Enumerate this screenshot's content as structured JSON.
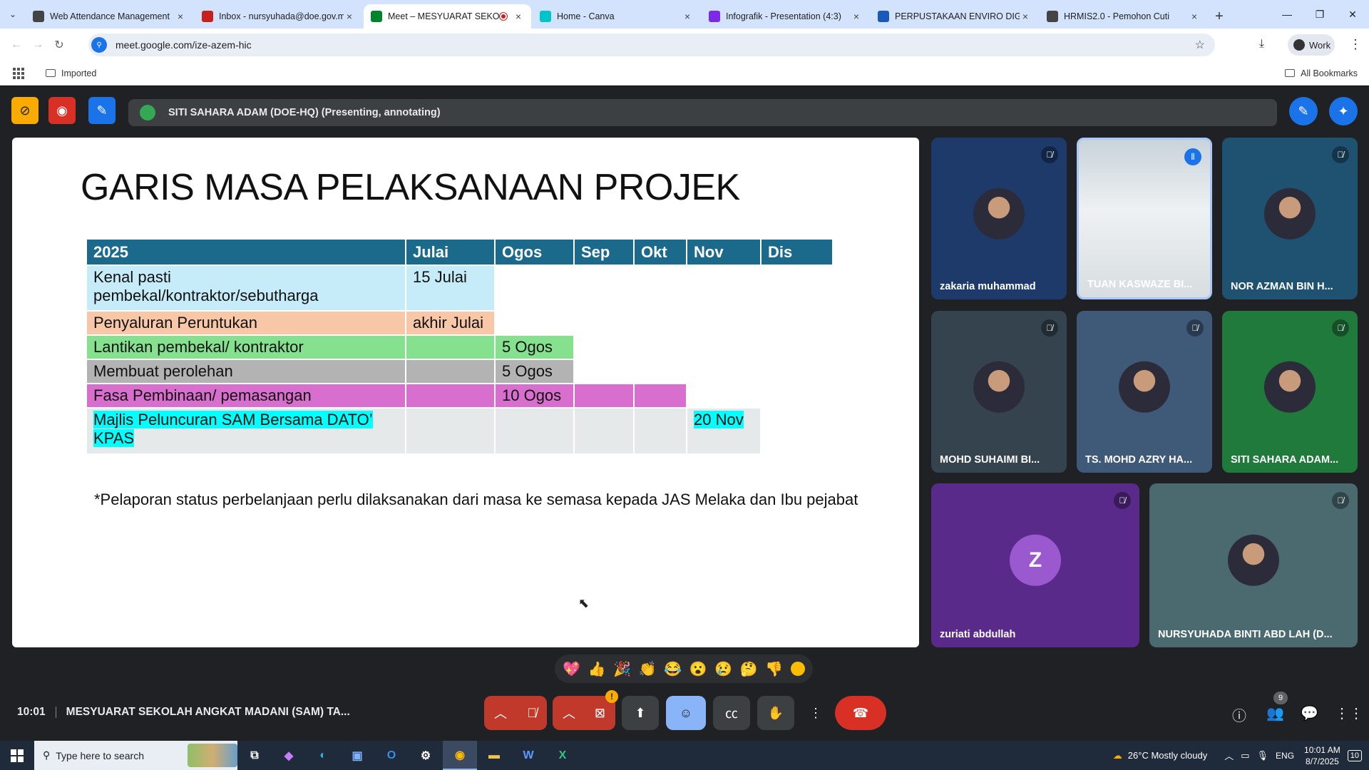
{
  "tabs": [
    {
      "title": "Web Attendance Management",
      "color": "#444"
    },
    {
      "title": "Inbox - nursyuhada@doe.gov.m",
      "color": "#c5221f"
    },
    {
      "title": "Meet – MESYUARAT SEKOL",
      "color": "#00832d",
      "active": true
    },
    {
      "title": "Home - Canva",
      "color": "#00c4cc"
    },
    {
      "title": "Infografik - Presentation (4:3)",
      "color": "#7d2ae8"
    },
    {
      "title": "PERPUSTAKAAN ENVIRO DIGIT",
      "color": "#185abc"
    },
    {
      "title": "HRMIS2.0 - Pemohon Cuti",
      "color": "#444"
    }
  ],
  "address": {
    "url": "meet.google.com/ize-azem-hic"
  },
  "profile": {
    "label": "Work"
  },
  "bookmarks": {
    "folder": "Imported",
    "all": "All Bookmarks"
  },
  "presenter": {
    "text": "SITI SAHARA ADAM (DOE-HQ) (Presenting, annotating)"
  },
  "slide": {
    "title": "GARIS MASA PELAKSANAAN PROJEK",
    "headers": [
      "2025",
      "Julai",
      "Ogos",
      "Sep",
      "Okt",
      "Nov",
      "Dis"
    ],
    "rows": [
      {
        "label": "Kenal pasti pembekal/kontraktor/sebutharga",
        "cells": [
          "15 Julai",
          "",
          "",
          "",
          "",
          ""
        ]
      },
      {
        "label": "Penyaluran Peruntukan",
        "cells": [
          "akhir Julai",
          "",
          "",
          "",
          "",
          ""
        ]
      },
      {
        "label": "Lantikan pembekal/ kontraktor",
        "cells": [
          "",
          "5 Ogos",
          "",
          "",
          "",
          ""
        ]
      },
      {
        "label": "Membuat perolehan",
        "cells": [
          "",
          "5 Ogos",
          "",
          "",
          "",
          ""
        ]
      },
      {
        "label": "Fasa Pembinaan/ pemasangan",
        "cells": [
          "",
          "10 Ogos",
          "",
          "",
          "",
          ""
        ]
      },
      {
        "label": "Majlis Peluncuran SAM Bersama DATO’ KPAS",
        "cells": [
          "",
          "",
          "",
          "",
          "20 Nov",
          ""
        ]
      }
    ],
    "row_colors": [
      "#c5ecf8",
      "#f7c7a8",
      "#86e18f",
      "#b3b3b3",
      "#d86fcf",
      "#e6e9ea"
    ],
    "footnote": "*Pelaporan status perbelanjaan perlu dilaksanakan dari masa ke semasa kepada JAS Melaka dan Ibu pejabat"
  },
  "participants": [
    {
      "name": "zakaria muhammad",
      "bg": "#1e3a6a",
      "muted": true
    },
    {
      "name": "TUAN KASWAZE BI...",
      "bg": "#9aa7b0",
      "muted": false,
      "video": true
    },
    {
      "name": "NOR AZMAN BIN H...",
      "bg": "#1e5270",
      "muted": true
    },
    {
      "name": "MOHD SUHAIMI BI...",
      "bg": "#34434e",
      "muted": true
    },
    {
      "name": "TS. MOHD AZRY HA...",
      "bg": "#3f5a78",
      "muted": true
    },
    {
      "name": "SITI SAHARA ADAM...",
      "bg": "#1f7a3b",
      "muted": true
    },
    {
      "name": "zuriati abdullah",
      "bg": "#5a2a8a",
      "muted": true,
      "initial": "Z"
    },
    {
      "name": "NURSYUHADA BINTI ABD LAH (D...",
      "bg": "#4a6a70",
      "muted": true
    }
  ],
  "reactions": [
    "💖",
    "👍",
    "🎉",
    "👏",
    "😂",
    "😮",
    "😢",
    "🤔",
    "👎"
  ],
  "meeting": {
    "time": "10:01",
    "title": "MESYUARAT SEKOLAH ANGKAT MADANI (SAM) TA...",
    "participant_count": "9"
  },
  "taskbar": {
    "search_placeholder": "Type here to search",
    "weather": "26°C  Mostly cloudy",
    "lang": "ENG",
    "time": "10:01 AM",
    "date": "8/7/2025",
    "notif": "10"
  }
}
